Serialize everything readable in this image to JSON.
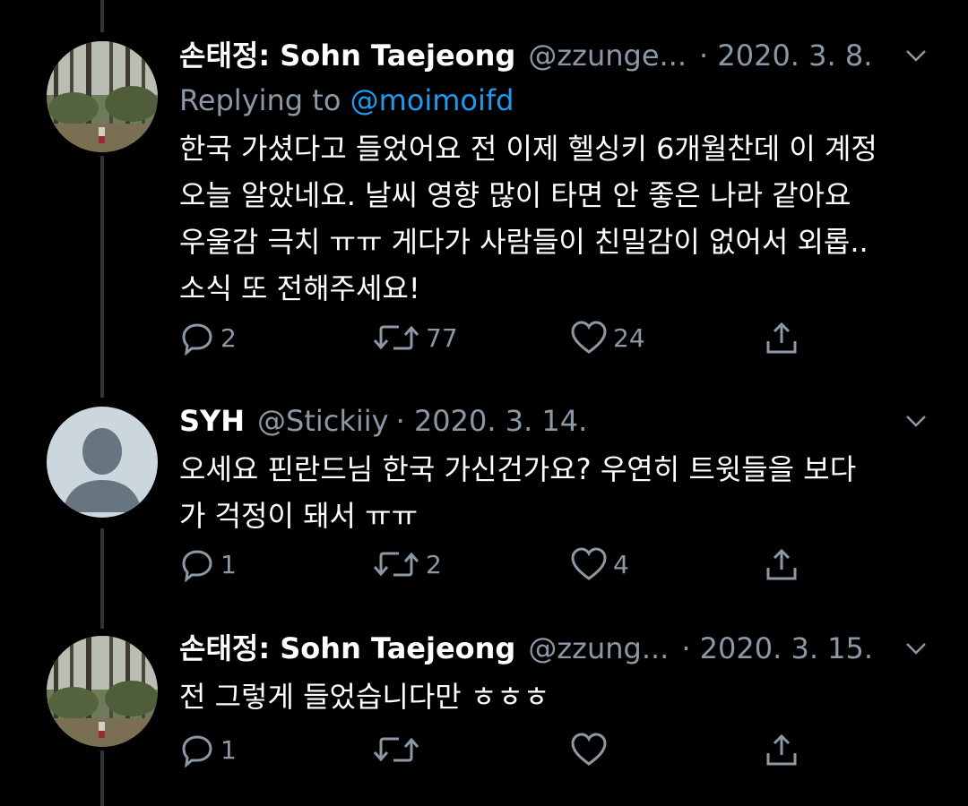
{
  "tweets": [
    {
      "name": "손태정: Sohn Taejeong",
      "handle": "@zzunge...",
      "date": "· 2020. 3. 8.",
      "replying_label": "Replying to",
      "replying_handle": "@moimoifd",
      "text_lines": [
        "한국 가셨다고 들었어요 전 이제 헬싱키 6개월찬데 이 계정",
        "오늘 알았네요. 날씨 영향 많이 타면 안 좋은 나라 같아요",
        "우울감 극치 ㅠㅠ 게다가 사람들이 친밀감이 없어서 외롭..",
        "소식 또 전해주세요!"
      ],
      "replies": "2",
      "retweets": "77",
      "likes": "24"
    },
    {
      "name": "SYH",
      "handle": "@Stickiiy",
      "date": "· 2020. 3. 14.",
      "text_lines": [
        "오세요 핀란드님 한국 가신건가요? 우연히 트윗들을 보다",
        "가 걱정이 돼서 ㅠㅠ"
      ],
      "replies": "1",
      "retweets": "2",
      "likes": "4"
    },
    {
      "name": "손태정: Sohn Taejeong",
      "handle": "@zzung...",
      "date": "· 2020. 3. 15.",
      "text_lines": [
        "전 그렇게 들었습니다만 ㅎㅎㅎ"
      ],
      "replies": "1",
      "retweets": "",
      "likes": ""
    }
  ],
  "colors": {
    "background": "#000000",
    "secondary_text": "#8b98a5",
    "link": "#1d9bf0",
    "thread_line": "#2f3336"
  },
  "icons": [
    "reply-icon",
    "retweet-icon",
    "like-icon",
    "share-icon",
    "chevron-down-icon"
  ]
}
